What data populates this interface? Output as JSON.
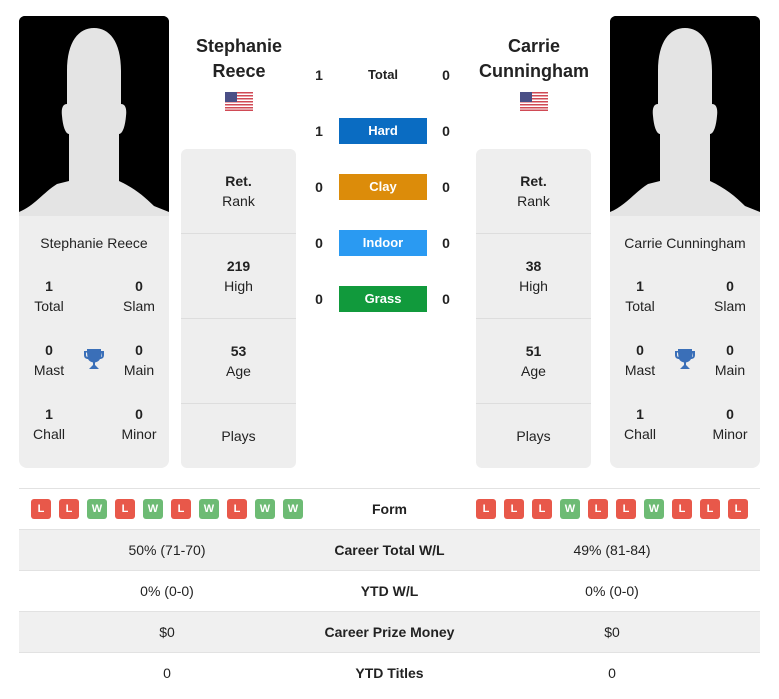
{
  "players": [
    {
      "name": "Stephanie Reece",
      "name_line1": "Stephanie",
      "name_line2": "Reece",
      "flag": "us-flag-icon",
      "rank_value": "Ret.",
      "rank_label": "Rank",
      "high_value": "219",
      "high_label": "High",
      "age_value": "53",
      "age_label": "Age",
      "plays_label": "Plays",
      "titles": {
        "total": "1",
        "total_label": "Total",
        "slam": "0",
        "slam_label": "Slam",
        "mast": "0",
        "mast_label": "Mast",
        "main": "0",
        "main_label": "Main",
        "chall": "1",
        "chall_label": "Chall",
        "minor": "0",
        "minor_label": "Minor"
      },
      "form": [
        "L",
        "L",
        "W",
        "L",
        "W",
        "L",
        "W",
        "L",
        "W",
        "W"
      ]
    },
    {
      "name": "Carrie Cunningham",
      "name_line1": "Carrie",
      "name_line2": "Cunningham",
      "flag": "us-flag-icon",
      "rank_value": "Ret.",
      "rank_label": "Rank",
      "high_value": "38",
      "high_label": "High",
      "age_value": "51",
      "age_label": "Age",
      "plays_label": "Plays",
      "titles": {
        "total": "1",
        "total_label": "Total",
        "slam": "0",
        "slam_label": "Slam",
        "mast": "0",
        "mast_label": "Mast",
        "main": "0",
        "main_label": "Main",
        "chall": "1",
        "chall_label": "Chall",
        "minor": "0",
        "minor_label": "Minor"
      },
      "form": [
        "L",
        "L",
        "L",
        "W",
        "L",
        "L",
        "W",
        "L",
        "L",
        "L"
      ]
    }
  ],
  "h2h": [
    {
      "label": "Total",
      "left": "1",
      "right": "0",
      "color": ""
    },
    {
      "label": "Hard",
      "left": "1",
      "right": "0",
      "color": "#0a6cc2"
    },
    {
      "label": "Clay",
      "left": "0",
      "right": "0",
      "color": "#dc8c0a"
    },
    {
      "label": "Indoor",
      "left": "0",
      "right": "0",
      "color": "#2a9af2"
    },
    {
      "label": "Grass",
      "left": "0",
      "right": "0",
      "color": "#119a3c"
    }
  ],
  "comparison": {
    "form_label": "Form",
    "rows": [
      {
        "label": "Career Total W/L",
        "left": "50% (71-70)",
        "right": "49% (81-84)"
      },
      {
        "label": "YTD W/L",
        "left": "0% (0-0)",
        "right": "0% (0-0)"
      },
      {
        "label": "Career Prize Money",
        "left": "$0",
        "right": "$0"
      },
      {
        "label": "YTD Titles",
        "left": "0",
        "right": "0"
      }
    ]
  },
  "colors": {
    "loss": "#e8584a",
    "win": "#6dbb74",
    "trophy": "#3a6fb8"
  }
}
